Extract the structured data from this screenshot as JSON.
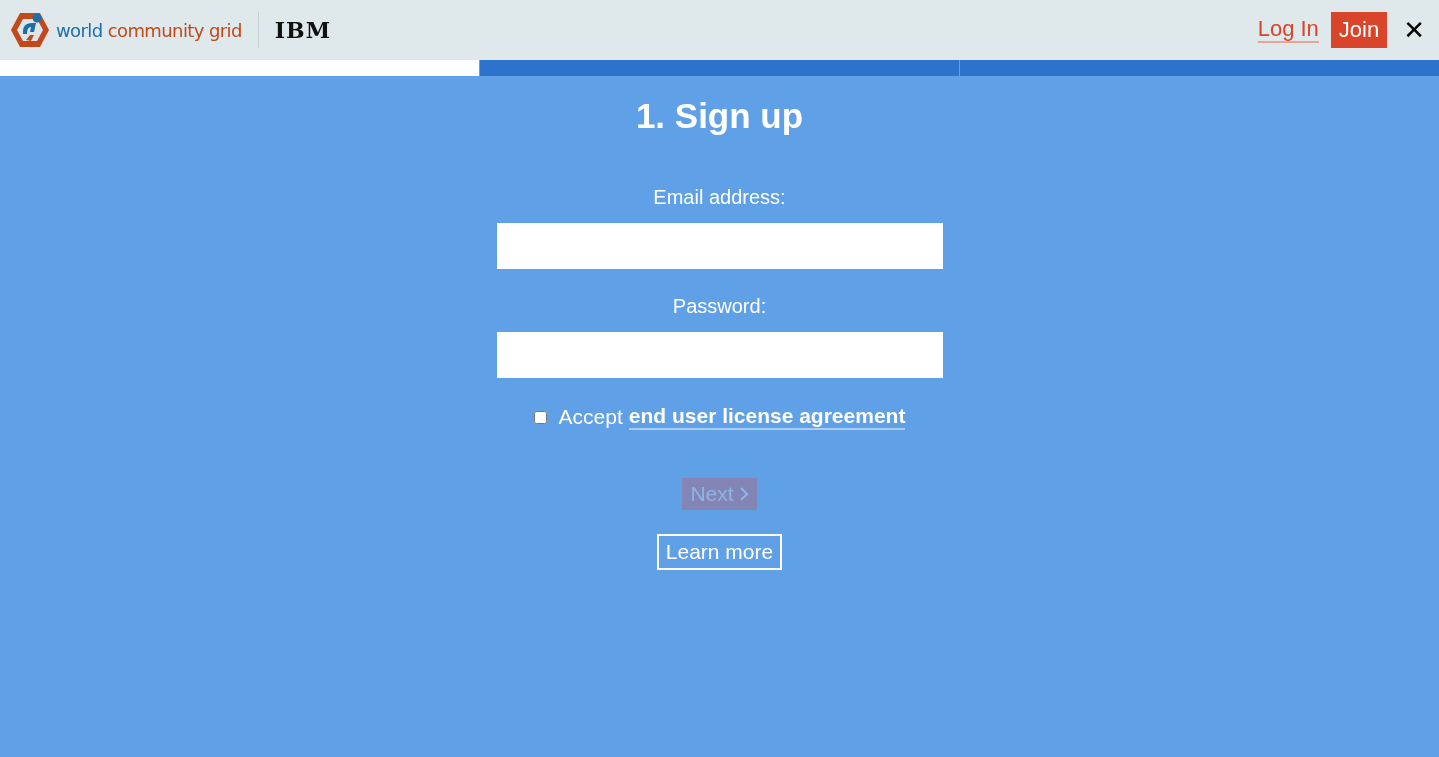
{
  "header": {
    "logo_word_1": "world",
    "logo_word_2": "community grid",
    "partner_logo": "IBM",
    "login_link": "Log In",
    "join_button": "Join",
    "close_button": "✕"
  },
  "progress_steps": [
    {
      "selected": true
    },
    {
      "selected": false
    },
    {
      "selected": false
    }
  ],
  "form": {
    "title": "1. Sign up",
    "email_label": "Email address:",
    "password_label": "Password:",
    "accept": {
      "checked": false,
      "text": "Accept",
      "link": "end user license agreement"
    },
    "next_button": {
      "label": "Next",
      "disabled": true
    },
    "learn_more_button": "Learn more"
  }
}
